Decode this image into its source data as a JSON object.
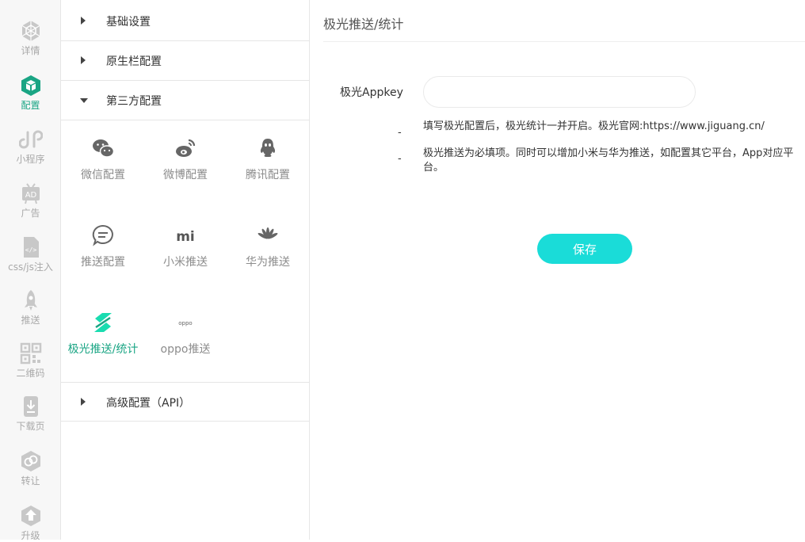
{
  "sidebar": {
    "items": [
      {
        "label": "详情"
      },
      {
        "label": "配置"
      },
      {
        "label": "小程序"
      },
      {
        "label": "广告"
      },
      {
        "label": "css/js注入"
      },
      {
        "label": "推送"
      },
      {
        "label": "二维码"
      },
      {
        "label": "下载页"
      },
      {
        "label": "转让"
      },
      {
        "label": "升级"
      }
    ],
    "icon_texts": {
      "ad": "AD",
      "code": "</>"
    }
  },
  "menu": {
    "sections": [
      {
        "label": "基础设置"
      },
      {
        "label": "原生栏配置"
      },
      {
        "label": "第三方配置"
      },
      {
        "label": "高级配置（API）"
      }
    ],
    "tiles": [
      {
        "label": "微信配置"
      },
      {
        "label": "微博配置"
      },
      {
        "label": "腾讯配置"
      },
      {
        "label": "推送配置"
      },
      {
        "label": "小米推送"
      },
      {
        "label": "华为推送"
      },
      {
        "label": "极光推送/统计"
      },
      {
        "label": "oppo推送"
      }
    ],
    "icon_texts": {
      "mi": "mi",
      "oppo": "oppo"
    }
  },
  "main": {
    "title": "极光推送/统计",
    "appkey_label": "极光Appkey",
    "appkey_value": "",
    "notes": [
      "填写极光配置后，极光统计一并开启。极光官网:https://www.jiguang.cn/",
      "极光推送为必填项。同时可以增加小米与华为推送，如配置其它平台，App对应平台。"
    ],
    "dash": "-",
    "save_label": "保存"
  },
  "colors": {
    "accent": "#1aa584",
    "button": "#1adcd8",
    "muted": "#a9a9a9"
  }
}
